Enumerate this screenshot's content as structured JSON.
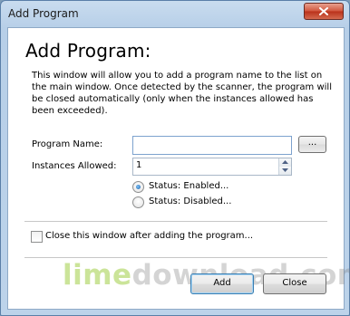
{
  "window": {
    "title": "Add Program",
    "close_icon": "close-icon"
  },
  "dialog": {
    "heading": "Add Program:",
    "description": "This window will allow you to add a program name to the list on the main window.  Once detected by the scanner, the program will be closed automatically (only when the instances allowed has been exceeded).",
    "program_name_label": "Program Name:",
    "program_name_value": "",
    "browse_label": "...",
    "instances_label": "Instances Allowed:",
    "instances_value": "1",
    "status_options": [
      {
        "label": "Status:  Enabled...",
        "checked": true
      },
      {
        "label": "Status:  Disabled...",
        "checked": false
      }
    ],
    "close_after_label": "Close this window after adding the program...",
    "close_after_checked": false,
    "add_label": "Add",
    "close_label": "Close"
  },
  "watermark": {
    "part1": "lime",
    "part2": "download.com"
  },
  "colors": {
    "title_bg": "#b7cfe8",
    "close_button": "#c8452b",
    "textbox_border": "#7da2ce",
    "default_button_border": "#3c7fb1"
  }
}
